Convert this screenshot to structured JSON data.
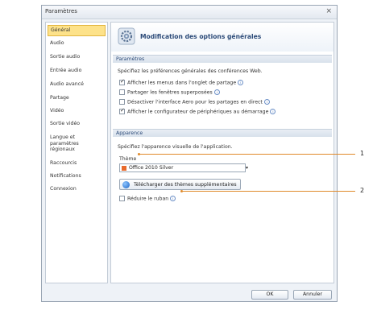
{
  "window": {
    "title": "Paramètres",
    "close_glyph": "⨯"
  },
  "sidebar": {
    "items": [
      {
        "label": "Général",
        "selected": true
      },
      {
        "label": "Audio"
      },
      {
        "label": "Sortie audio"
      },
      {
        "label": "Entrée audio"
      },
      {
        "label": "Audio avancé"
      },
      {
        "label": "Partage"
      },
      {
        "label": "Vidéo"
      },
      {
        "label": "Sortie vidéo"
      },
      {
        "label": "Langue et paramètres régionaux"
      },
      {
        "label": "Raccourcis"
      },
      {
        "label": "Notifications"
      },
      {
        "label": "Connexion"
      }
    ]
  },
  "header": {
    "title": "Modification des options générales",
    "icon": "gear-icon"
  },
  "parametres": {
    "section_title": "Paramètres",
    "description": "Spécifiez les préférences générales des conférences Web.",
    "options": [
      {
        "label": "Afficher les menus dans l'onglet de partage",
        "checked": true
      },
      {
        "label": "Partager les fenêtres superposées",
        "checked": false
      },
      {
        "label": "Désactiver l'interface Aero pour les partages en direct",
        "checked": false
      },
      {
        "label": "Afficher le configurateur de périphériques au démarrage",
        "checked": true
      }
    ]
  },
  "apparence": {
    "section_title": "Apparence",
    "description": "Spécifiez l'apparence visuelle de l'application.",
    "theme_label": "Thème",
    "theme_value": "Office 2010 Silver",
    "download_button": "Télécharger des thèmes supplémentaires",
    "reduce_ribbon_label": "Réduire le ruban",
    "reduce_ribbon_checked": false
  },
  "footer": {
    "ok_label": "OK",
    "cancel_label": "Annuler"
  },
  "callouts": [
    "1",
    "2"
  ],
  "colors": {
    "selected_bg": "#fde28a",
    "callout": "#e08a2b",
    "header_text": "#2b4a78"
  }
}
